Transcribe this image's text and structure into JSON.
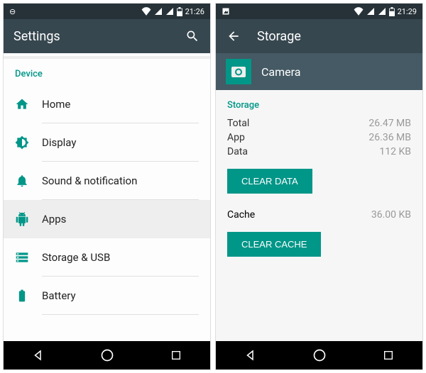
{
  "left": {
    "statusbar": {
      "time": "21:26"
    },
    "appbar": {
      "title": "Settings"
    },
    "section_label": "Device",
    "items": [
      {
        "label": "Home",
        "icon": "home-icon",
        "selected": false
      },
      {
        "label": "Display",
        "icon": "display-icon",
        "selected": false
      },
      {
        "label": "Sound & notification",
        "icon": "bell-icon",
        "selected": false
      },
      {
        "label": "Apps",
        "icon": "android-icon",
        "selected": true
      },
      {
        "label": "Storage & USB",
        "icon": "storage-icon",
        "selected": false
      },
      {
        "label": "Battery",
        "icon": "battery-icon",
        "selected": false
      }
    ]
  },
  "right": {
    "statusbar": {
      "time": "21:29"
    },
    "appbar": {
      "title": "Storage"
    },
    "subheader": {
      "app_name": "Camera"
    },
    "section_label": "Storage",
    "rows": {
      "total": {
        "label": "Total",
        "value": "26.47 MB"
      },
      "app": {
        "label": "App",
        "value": "26.36 MB"
      },
      "data": {
        "label": "Data",
        "value": "112 KB"
      }
    },
    "clear_data_label": "CLEAR DATA",
    "cache": {
      "label": "Cache",
      "value": "36.00 KB"
    },
    "clear_cache_label": "CLEAR CACHE"
  }
}
